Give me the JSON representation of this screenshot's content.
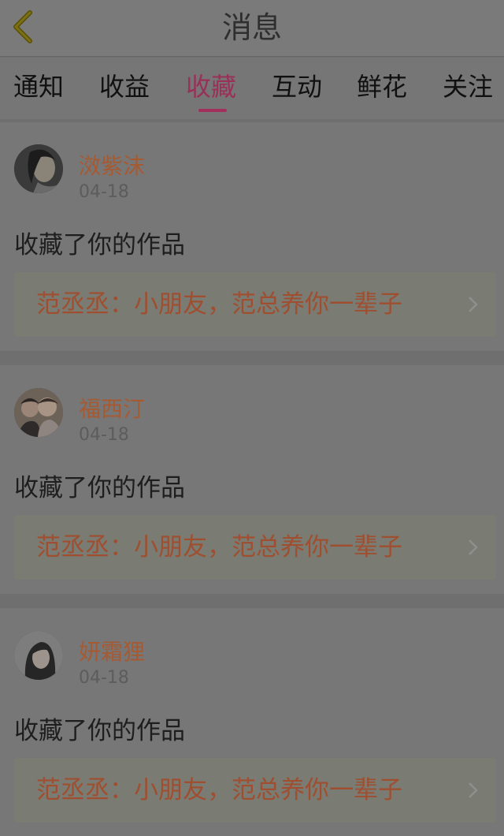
{
  "header": {
    "title": "消息"
  },
  "tabs": [
    {
      "label": "通知"
    },
    {
      "label": "收益"
    },
    {
      "label": "收藏"
    },
    {
      "label": "互动"
    },
    {
      "label": "鲜花"
    },
    {
      "label": "关注"
    }
  ],
  "active_tab_index": 2,
  "messages": [
    {
      "username": "滧紫沫",
      "date": "04-18",
      "action": "收藏了你的作品",
      "work_title": "范丞丞：小朋友，范总养你一辈子"
    },
    {
      "username": "福西汀",
      "date": "04-18",
      "action": "收藏了你的作品",
      "work_title": "范丞丞：小朋友，范总养你一辈子"
    },
    {
      "username": "妍霜狸",
      "date": "04-18",
      "action": "收藏了你的作品",
      "work_title": "范丞丞：小朋友，范总养你一辈子"
    }
  ],
  "colors": {
    "accent": "#a22f5c",
    "username": "#a65a32",
    "work_title": "#9f4f30"
  },
  "icons": {
    "back": "back-arrow-icon",
    "chevron": "chevron-right-icon"
  }
}
